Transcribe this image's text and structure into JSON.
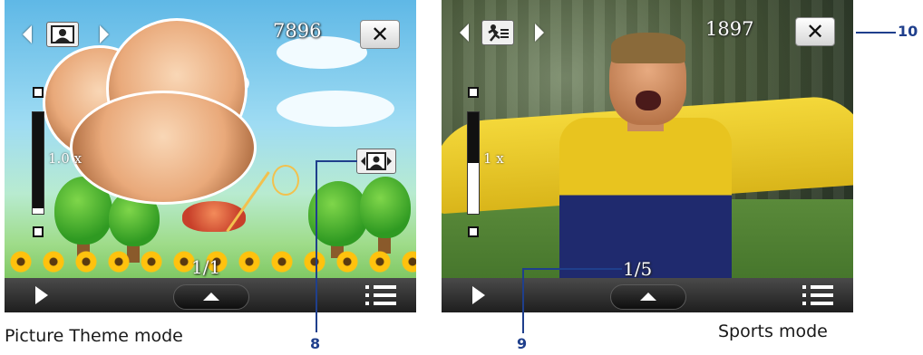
{
  "screen_picture_theme": {
    "counter": "7896",
    "zoom_label": "1.0 x",
    "zoom_level": 0.95,
    "page_indicator": "1/1",
    "close_symbol": "✕"
  },
  "screen_sports": {
    "counter": "1897",
    "zoom_label": "1 x",
    "zoom_level": 0.5,
    "page_indicator": "1/5",
    "close_symbol": "✕"
  },
  "captions": {
    "left": "Picture Theme mode",
    "right": "Sports mode"
  },
  "callouts": {
    "eight": "8",
    "nine": "9",
    "ten": "10"
  },
  "colors": {
    "callout": "#1f3f8c",
    "bottom_bar": "#1e1e1e"
  },
  "icons": {
    "mode_picture_theme": "portrait-frame-icon",
    "mode_sports": "runner-icon",
    "template_select": "portrait-frame-arrows-icon",
    "close": "close-icon",
    "play": "play-icon",
    "up": "chevron-up-icon",
    "menu": "menu-list-icon"
  }
}
